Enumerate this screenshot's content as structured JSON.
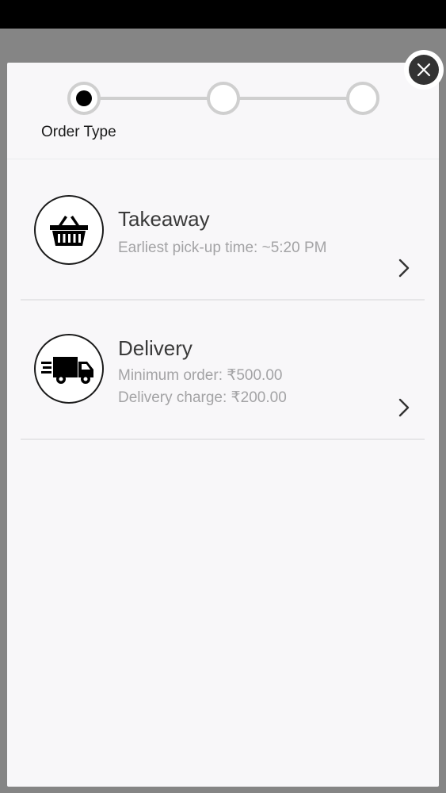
{
  "stepper": {
    "current_step_label": "Order Type"
  },
  "options": [
    {
      "title": "Takeaway",
      "details": [
        "Earliest pick-up time: ~5:20 PM"
      ],
      "icon": "basket-icon"
    },
    {
      "title": "Delivery",
      "details": [
        "Minimum order: ₹500.00",
        "Delivery charge: ₹200.00"
      ],
      "icon": "delivery-van-icon"
    }
  ],
  "colors": {
    "overlay": "#858585",
    "modal_bg": "#f8f7f9",
    "step_inactive": "#cfcfcf",
    "step_active": "#000000",
    "subtitle": "#a3a3a5",
    "close_button": "#333333"
  }
}
